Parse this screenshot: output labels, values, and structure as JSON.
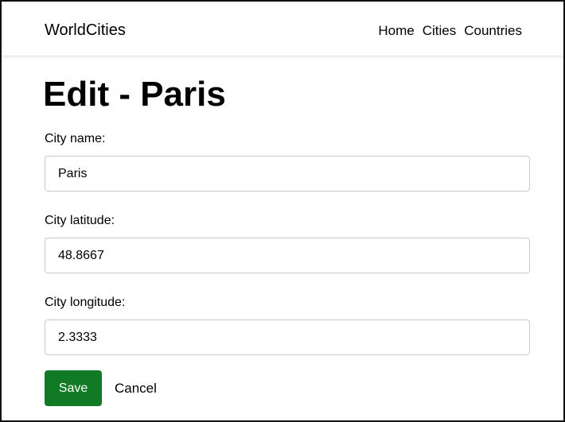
{
  "navbar": {
    "brand": "WorldCities",
    "links": [
      {
        "label": "Home"
      },
      {
        "label": "Cities"
      },
      {
        "label": "Countries"
      }
    ]
  },
  "page": {
    "title": "Edit - Paris"
  },
  "form": {
    "fields": [
      {
        "label": "City name:",
        "value": "Paris"
      },
      {
        "label": "City latitude:",
        "value": "48.8667"
      },
      {
        "label": "City longitude:",
        "value": "2.3333"
      }
    ],
    "save_label": "Save",
    "cancel_label": "Cancel"
  },
  "colors": {
    "save_button": "#117a25"
  }
}
